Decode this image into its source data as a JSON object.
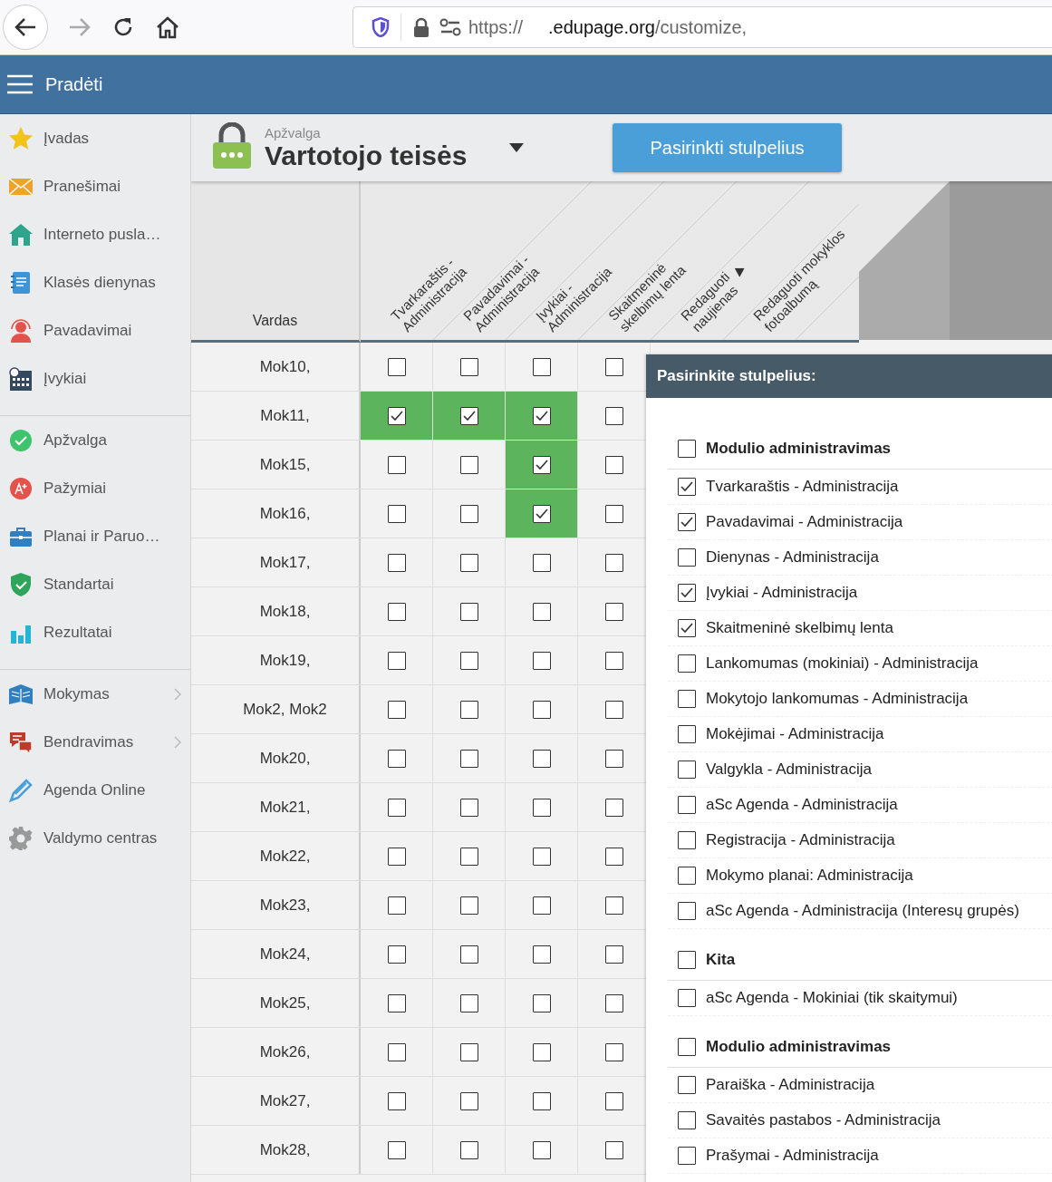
{
  "browser": {
    "forward_disabled": true,
    "url": {
      "scheme": "https://",
      "domain": ".edupage.org",
      "path": "/customize,"
    }
  },
  "app_bar": {
    "title": "Pradėti"
  },
  "sidebar": {
    "groups": [
      {
        "items": [
          {
            "label": "Įvadas",
            "submenu": false
          },
          {
            "label": "Pranešimai",
            "submenu": false
          },
          {
            "label": "Interneto pusla…",
            "submenu": false
          },
          {
            "label": "Klasės dienynas",
            "submenu": false
          },
          {
            "label": "Pavadavimai",
            "submenu": false
          },
          {
            "label": "Įvykiai",
            "submenu": false
          }
        ]
      },
      {
        "items": [
          {
            "label": "Apžvalga",
            "submenu": false
          },
          {
            "label": "Pažymiai",
            "submenu": false
          },
          {
            "label": "Planai ir Paruo…",
            "submenu": false
          },
          {
            "label": "Standartai",
            "submenu": false
          },
          {
            "label": "Rezultatai",
            "submenu": false
          }
        ]
      },
      {
        "items": [
          {
            "label": "Mokymas",
            "submenu": true
          },
          {
            "label": "Bendravimas",
            "submenu": true
          },
          {
            "label": "Agenda Online",
            "submenu": false
          },
          {
            "label": "Valdymo centras",
            "submenu": false
          }
        ]
      }
    ]
  },
  "header": {
    "breadcrumb": "Apžvalga",
    "title": "Vartotojo teisės",
    "button": "Pasirinkti stulpelius"
  },
  "table": {
    "name_column": "Vardas",
    "columns": [
      {
        "lines": [
          "Tvarkaraštis -",
          "Administracija"
        ],
        "sorted": false
      },
      {
        "lines": [
          "Pavadavimai -",
          "Administracija"
        ],
        "sorted": false
      },
      {
        "lines": [
          "Įvykiai -",
          "Administracija"
        ],
        "sorted": false
      },
      {
        "lines": [
          "Skaitmeninė",
          "skelbimų lenta"
        ],
        "sorted": false
      },
      {
        "lines": [
          "Redaguoti",
          "naujienas"
        ],
        "sorted": true
      },
      {
        "lines": [
          "Redaguoti mokyklos",
          "fotoalbumą"
        ],
        "sorted": false
      }
    ],
    "rows": [
      {
        "name": "Mok10,",
        "cells": [
          false,
          false,
          false,
          false
        ]
      },
      {
        "name": "Mok11,",
        "cells": [
          true,
          true,
          true,
          false
        ]
      },
      {
        "name": "Mok15,",
        "cells": [
          false,
          false,
          true,
          false
        ]
      },
      {
        "name": "Mok16,",
        "cells": [
          false,
          false,
          true,
          false
        ]
      },
      {
        "name": "Mok17,",
        "cells": [
          false,
          false,
          false,
          false
        ]
      },
      {
        "name": "Mok18,",
        "cells": [
          false,
          false,
          false,
          false
        ]
      },
      {
        "name": "Mok19,",
        "cells": [
          false,
          false,
          false,
          false
        ]
      },
      {
        "name": "Mok2, Mok2",
        "cells": [
          false,
          false,
          false,
          false
        ]
      },
      {
        "name": "Mok20,",
        "cells": [
          false,
          false,
          false,
          false
        ]
      },
      {
        "name": "Mok21,",
        "cells": [
          false,
          false,
          false,
          false
        ]
      },
      {
        "name": "Mok22,",
        "cells": [
          false,
          false,
          false,
          false
        ]
      },
      {
        "name": "Mok23,",
        "cells": [
          false,
          false,
          false,
          false
        ]
      },
      {
        "name": "Mok24,",
        "cells": [
          false,
          false,
          false,
          false
        ]
      },
      {
        "name": "Mok25,",
        "cells": [
          false,
          false,
          false,
          false
        ]
      },
      {
        "name": "Mok26,",
        "cells": [
          false,
          false,
          false,
          false
        ]
      },
      {
        "name": "Mok27,",
        "cells": [
          false,
          false,
          false,
          false
        ]
      },
      {
        "name": "Mok28,",
        "cells": [
          false,
          false,
          false,
          false
        ]
      }
    ]
  },
  "panel": {
    "title": "Pasirinkite stulpelius:",
    "groups": [
      {
        "label": "Modulio administravimas",
        "checked": false,
        "items": [
          {
            "label": "Tvarkaraštis - Administracija",
            "checked": true
          },
          {
            "label": "Pavadavimai - Administracija",
            "checked": true
          },
          {
            "label": "Dienynas - Administracija",
            "checked": false
          },
          {
            "label": "Įvykiai - Administracija",
            "checked": true
          },
          {
            "label": "Skaitmeninė skelbimų lenta",
            "checked": true
          },
          {
            "label": "Lankomumas (mokiniai) - Administracija",
            "checked": false
          },
          {
            "label": "Mokytojo lankomumas - Administracija",
            "checked": false
          },
          {
            "label": "Mokėjimai - Administracija",
            "checked": false
          },
          {
            "label": "Valgykla - Administracija",
            "checked": false
          },
          {
            "label": "aSc Agenda - Administracija",
            "checked": false
          },
          {
            "label": "Registracija - Administracija",
            "checked": false
          },
          {
            "label": "Mokymo planai: Administracija",
            "checked": false
          },
          {
            "label": "aSc Agenda - Administracija (Interesų grupės)",
            "checked": false
          }
        ]
      },
      {
        "label": "Kita",
        "checked": false,
        "items": [
          {
            "label": "aSc Agenda - Mokiniai (tik skaitymui)",
            "checked": false
          }
        ]
      },
      {
        "label": "Modulio administravimas",
        "checked": false,
        "items": [
          {
            "label": "Paraiška - Administracija",
            "checked": false
          },
          {
            "label": "Savaitės pastabos - Administracija",
            "checked": false
          },
          {
            "label": "Prašymai - Administracija",
            "checked": false
          }
        ]
      }
    ]
  }
}
